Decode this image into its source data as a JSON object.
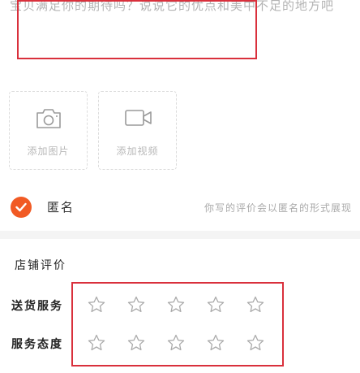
{
  "review": {
    "text": "宝贝满足你的期待吗？说说它的优点和美中不足的地方吧"
  },
  "media": {
    "add_photo_label": "添加图片",
    "add_video_label": "添加视频"
  },
  "anonymous": {
    "label": "匿名",
    "checked": true,
    "hint": "你写的评价会以匿名的形式展现"
  },
  "shop_rating": {
    "title": "店铺评价",
    "rows": [
      {
        "label": "送货服务",
        "stars_total": 5,
        "stars_filled": 0
      },
      {
        "label": "服务态度",
        "stars_total": 5,
        "stars_filled": 0
      }
    ]
  },
  "colors": {
    "accent": "#f15a24",
    "highlight_box": "#d9303c",
    "placeholder": "#b3b3b3"
  }
}
